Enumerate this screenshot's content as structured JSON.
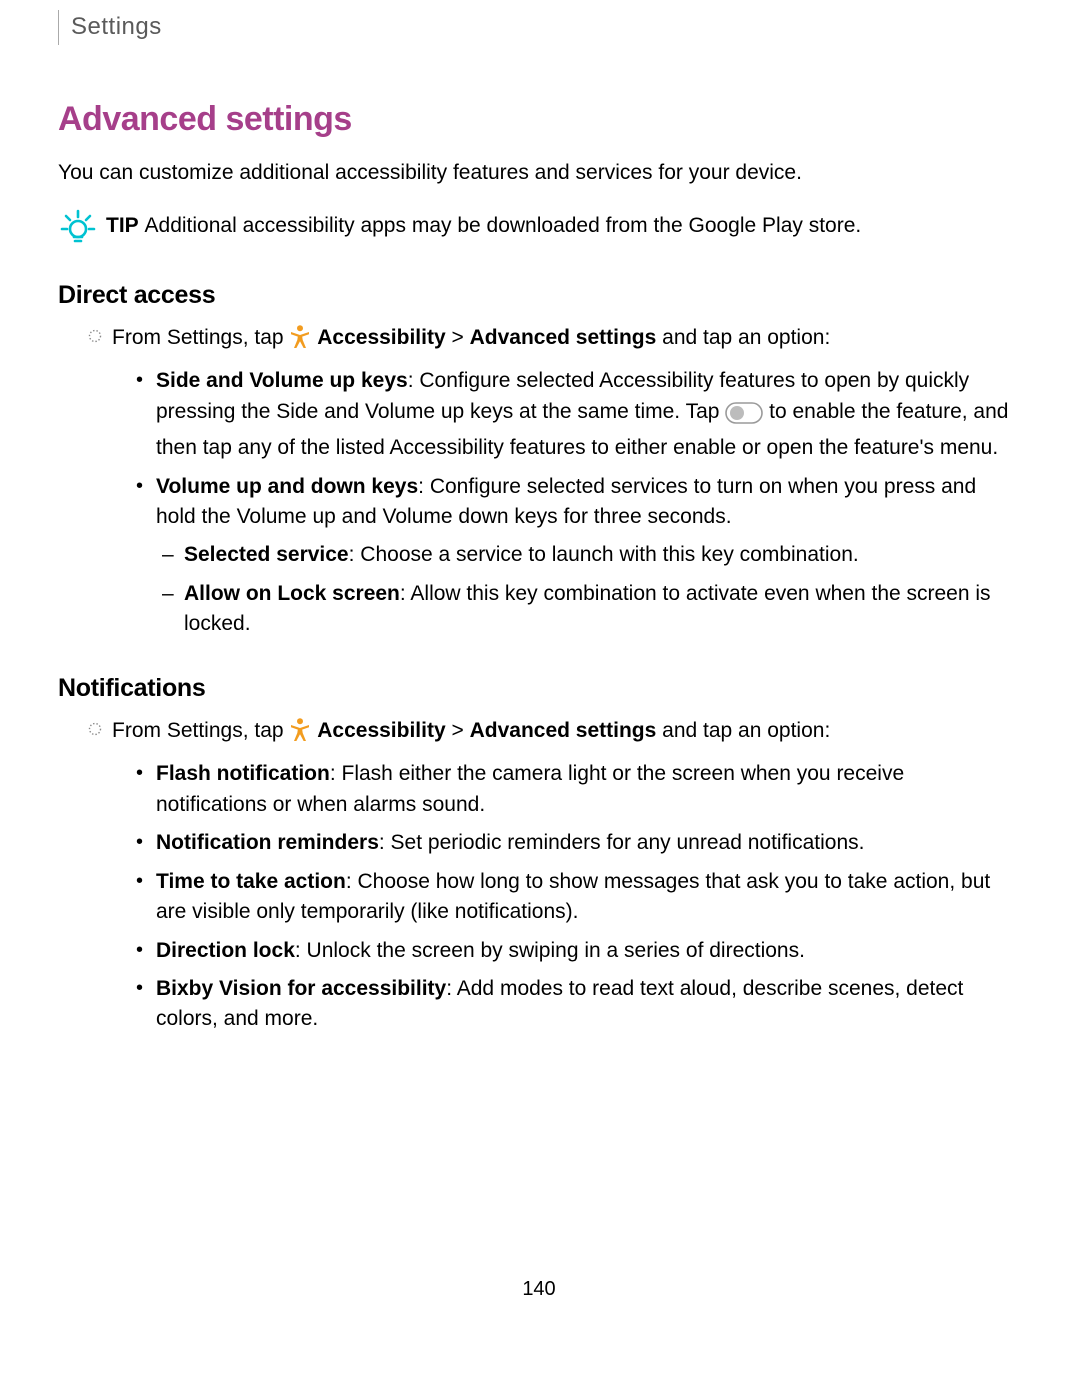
{
  "header": {
    "breadcrumb": "Settings"
  },
  "title": "Advanced settings",
  "intro": "You can customize additional accessibility features and services for your device.",
  "tip": {
    "label": "TIP",
    "text": "Additional accessibility apps may be downloaded from the Google Play store."
  },
  "sections": [
    {
      "heading": "Direct access",
      "step_prefix": "From Settings, tap ",
      "step_bold1": "Accessibility",
      "step_sep": " > ",
      "step_bold2": "Advanced settings",
      "step_suffix": " and tap an option:",
      "bullets": [
        {
          "bold": "Side and Volume up keys",
          "text_before_toggle": ": Configure selected Accessibility features to open by quickly pressing the Side and Volume up keys at the same time. Tap ",
          "text_after_toggle": " to enable the feature, and then tap any of the listed Accessibility features to either enable or open the feature's menu.",
          "has_toggle": true
        },
        {
          "bold": "Volume up and down keys",
          "text": ": Configure selected services to turn on when you press and hold the Volume up and Volume down keys for three seconds.",
          "sub": [
            {
              "bold": "Selected service",
              "text": ": Choose a service to launch with this key combination."
            },
            {
              "bold": "Allow on Lock screen",
              "text": ": Allow this key combination to activate even when the screen is locked."
            }
          ]
        }
      ]
    },
    {
      "heading": "Notifications",
      "step_prefix": "From Settings, tap ",
      "step_bold1": "Accessibility",
      "step_sep": " > ",
      "step_bold2": "Advanced settings",
      "step_suffix": " and tap an option:",
      "bullets": [
        {
          "bold": "Flash notification",
          "text": ": Flash either the camera light or the screen when you receive notifications or when alarms sound."
        },
        {
          "bold": "Notification reminders",
          "text": ": Set periodic reminders for any unread notifications."
        },
        {
          "bold": "Time to take action",
          "text": ": Choose how long to show messages that ask you to take action, but are visible only temporarily (like notifications)."
        },
        {
          "bold": "Direction lock",
          "text": ": Unlock the screen by swiping in a series of directions."
        },
        {
          "bold": "Bixby Vision for accessibility",
          "text": ": Add modes to read text aloud, describe scenes, detect colors, and more."
        }
      ]
    }
  ],
  "page_number": "140"
}
